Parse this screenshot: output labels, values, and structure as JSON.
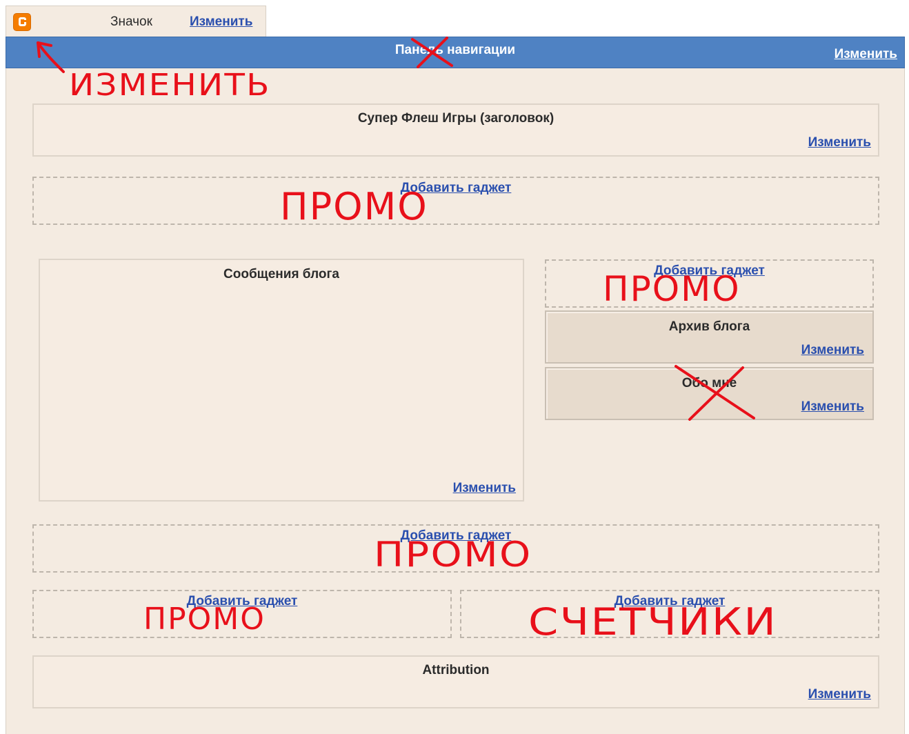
{
  "favicon_tab": {
    "label": "Значок",
    "edit": "Изменить"
  },
  "navbar": {
    "title": "Панель навигации",
    "edit": "Изменить"
  },
  "header": {
    "title": "Супер Флеш Игры (заголовок)",
    "edit": "Изменить"
  },
  "gadget_add": "Добавить гаджет",
  "posts": {
    "title": "Сообщения блога",
    "edit": "Изменить"
  },
  "sidebar": {
    "archive": {
      "title": "Архив блога",
      "edit": "Изменить"
    },
    "about": {
      "title": "Обо мне",
      "edit": "Изменить"
    }
  },
  "attribution": {
    "title": "Attribution",
    "edit": "Изменить"
  },
  "annotations": {
    "change": "ИЗМЕНИТЬ",
    "promo": "ПРОМО",
    "counters": "СЧЕТЧИКИ"
  },
  "colors": {
    "navbar": "#4f82c3",
    "link": "#2a4fae",
    "panel_bg": "#f4ebe1",
    "annotation_red": "#e8101a"
  }
}
